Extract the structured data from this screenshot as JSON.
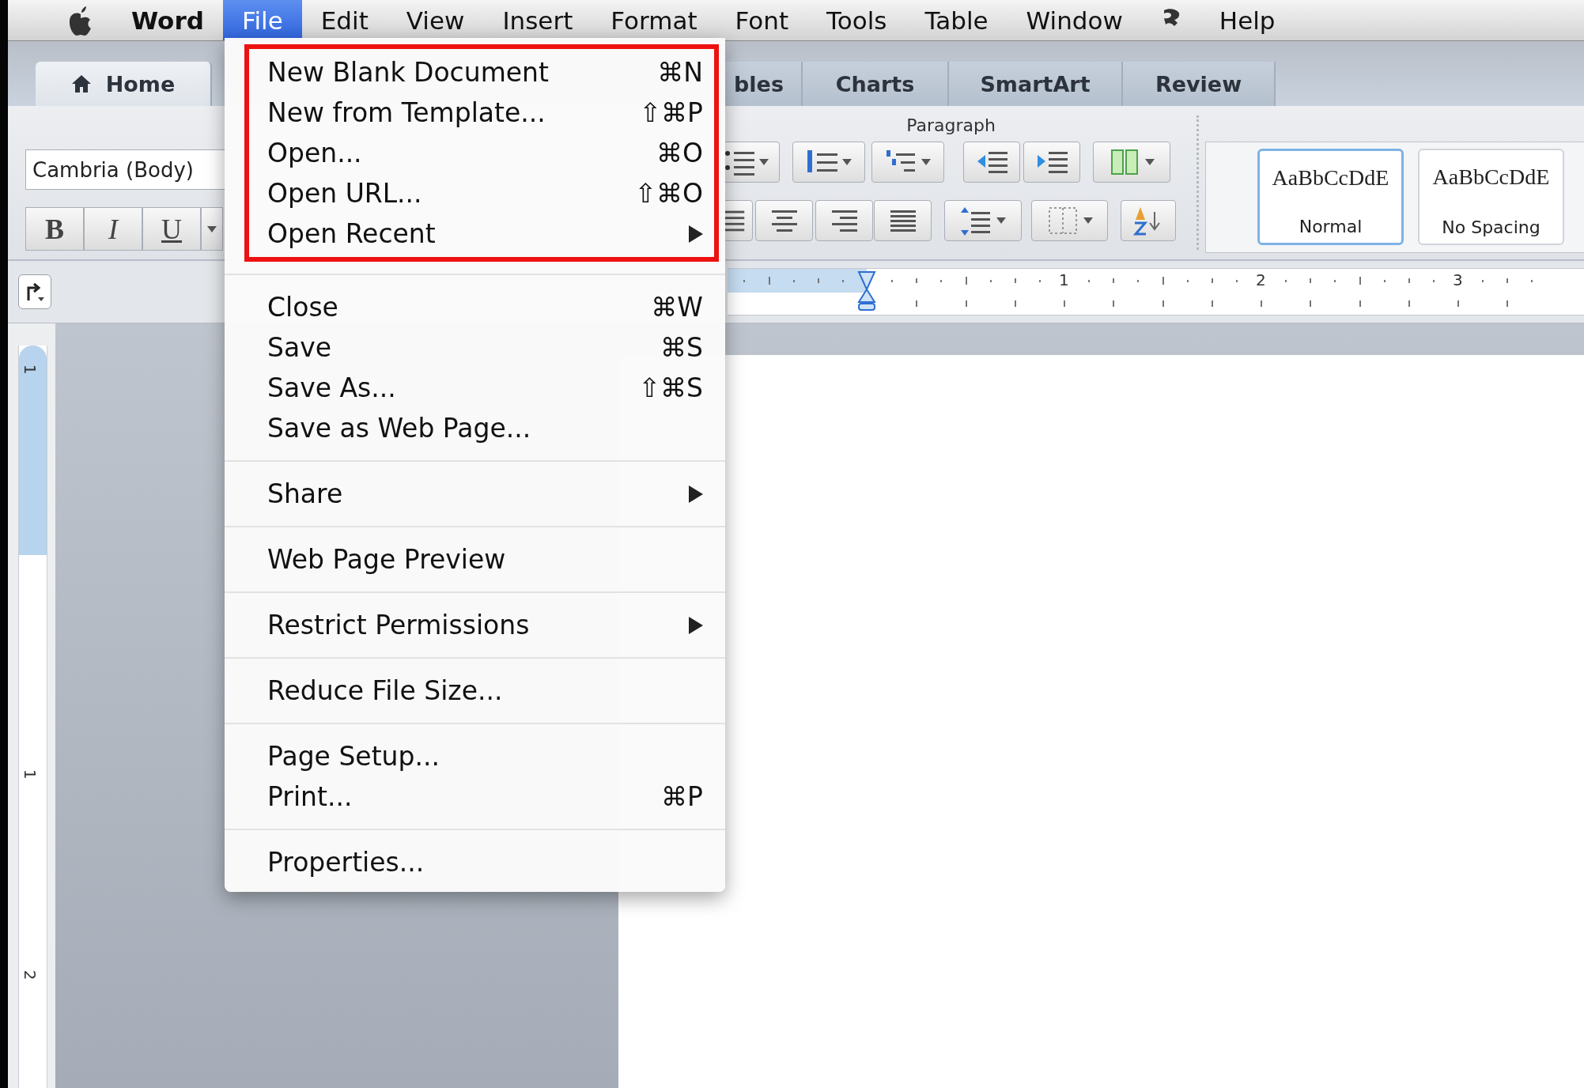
{
  "menu_bar": {
    "items": [
      {
        "kind": "apple",
        "selected": false
      },
      {
        "kind": "app",
        "label": "Word",
        "selected": false
      },
      {
        "kind": "menu",
        "label": "File",
        "selected": true
      },
      {
        "kind": "menu",
        "label": "Edit",
        "selected": false
      },
      {
        "kind": "menu",
        "label": "View",
        "selected": false
      },
      {
        "kind": "menu",
        "label": "Insert",
        "selected": false
      },
      {
        "kind": "menu",
        "label": "Format",
        "selected": false
      },
      {
        "kind": "menu",
        "label": "Font",
        "selected": false
      },
      {
        "kind": "menu",
        "label": "Tools",
        "selected": false
      },
      {
        "kind": "menu",
        "label": "Table",
        "selected": false
      },
      {
        "kind": "menu",
        "label": "Window",
        "selected": false
      },
      {
        "kind": "script",
        "selected": false
      },
      {
        "kind": "menu",
        "label": "Help",
        "selected": false
      }
    ]
  },
  "ribbon_tabs": [
    {
      "label": "Home",
      "kind": "home",
      "selected": true
    },
    {
      "label": "bles",
      "kind": "partial",
      "selected": false
    },
    {
      "label": "Charts",
      "kind": "tab",
      "selected": false
    },
    {
      "label": "SmartArt",
      "kind": "tab",
      "selected": false
    },
    {
      "label": "Review",
      "kind": "tab",
      "selected": false
    }
  ],
  "ribbon": {
    "font_name": "Cambria (Body)",
    "format_buttons": [
      "B",
      "I",
      "U"
    ],
    "paragraph_label": "Paragraph",
    "styles": [
      {
        "preview": "AaBbCcDdE",
        "name": "Normal",
        "selected": true
      },
      {
        "preview": "AaBbCcDdE",
        "name": "No Spacing",
        "selected": false
      }
    ]
  },
  "ruler": {
    "labels": [
      "1",
      "2",
      "3"
    ]
  },
  "vertical_ruler": {
    "labels": [
      "1",
      "1",
      "2"
    ]
  },
  "file_menu": {
    "groups": [
      {
        "items": [
          {
            "label": "New Blank Document",
            "shortcut": "⌘N",
            "has_submenu": false
          },
          {
            "label": "New from Template...",
            "shortcut": "⇧⌘P",
            "has_submenu": false
          },
          {
            "label": "Open...",
            "shortcut": "⌘O",
            "has_submenu": false
          },
          {
            "label": "Open URL...",
            "shortcut": "⇧⌘O",
            "has_submenu": false
          },
          {
            "label": "Open Recent",
            "has_submenu": true
          }
        ]
      },
      {
        "items": [
          {
            "label": "Close",
            "shortcut": "⌘W",
            "has_submenu": false
          },
          {
            "label": "Save",
            "shortcut": "⌘S",
            "has_submenu": false
          },
          {
            "label": "Save As...",
            "shortcut": "⇧⌘S",
            "has_submenu": false
          },
          {
            "label": "Save as Web Page...",
            "has_submenu": false
          }
        ]
      },
      {
        "items": [
          {
            "label": "Share",
            "has_submenu": true
          }
        ]
      },
      {
        "items": [
          {
            "label": "Web Page Preview",
            "has_submenu": false
          }
        ]
      },
      {
        "items": [
          {
            "label": "Restrict Permissions",
            "has_submenu": true
          }
        ]
      },
      {
        "items": [
          {
            "label": "Reduce File Size...",
            "has_submenu": false
          }
        ]
      },
      {
        "items": [
          {
            "label": "Page Setup...",
            "has_submenu": false
          },
          {
            "label": "Print...",
            "shortcut": "⌘P",
            "has_submenu": false
          }
        ]
      },
      {
        "items": [
          {
            "label": "Properties...",
            "has_submenu": false
          }
        ]
      }
    ]
  }
}
